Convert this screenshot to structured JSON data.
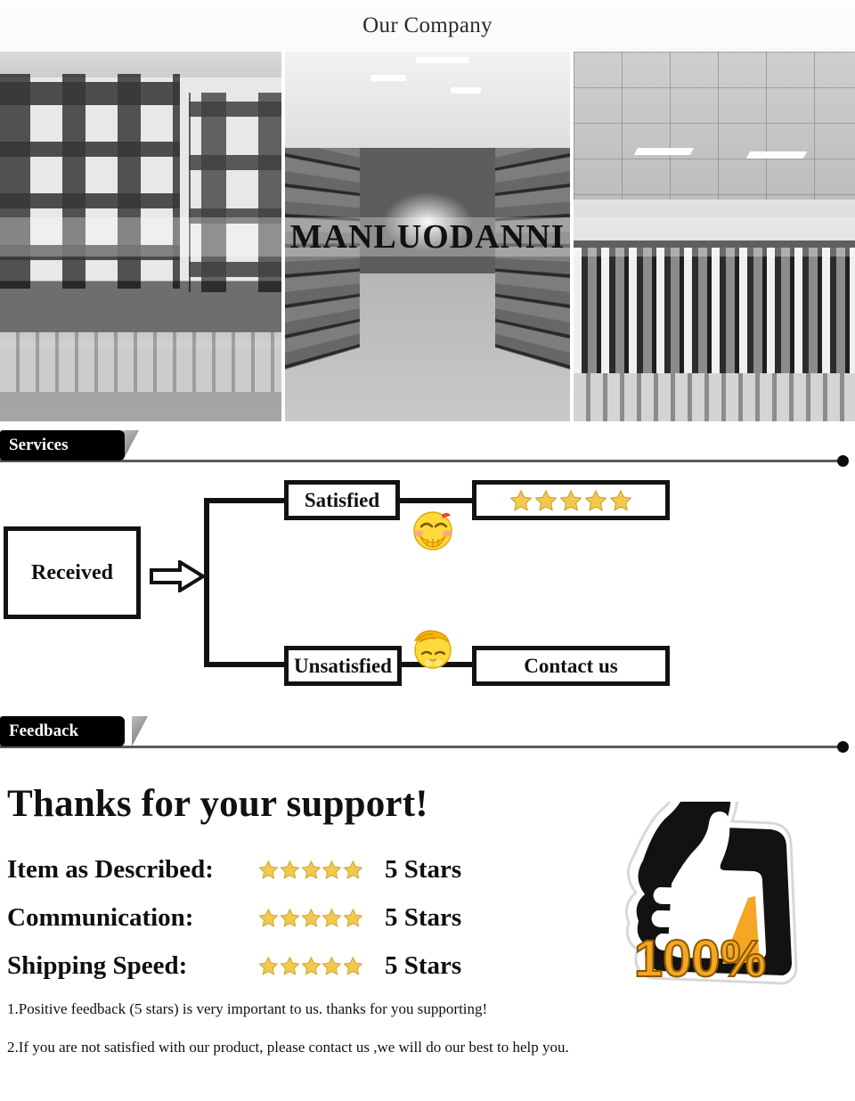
{
  "header": {
    "title": "Our Company"
  },
  "collage": {
    "watermark": "MANLUODANNI",
    "photos": [
      {
        "name": "factory-building-exterior",
        "alt": "Factory building exterior with stacked goods"
      },
      {
        "name": "warehouse-aisle",
        "alt": "Warehouse storage aisle with racks"
      },
      {
        "name": "showroom-clothing-racks",
        "alt": "Showroom with clothing racks and ceiling lights"
      }
    ]
  },
  "services": {
    "badge_label": "Services",
    "flow": {
      "start": "Received",
      "branch_top": "Satisfied",
      "branch_bottom": "Unsatisfied",
      "result_top_stars": 5,
      "result_bottom": "Contact us",
      "emoji_top": "happy-covering-mouth-emoji",
      "emoji_bottom": "facepalm-sad-emoji"
    }
  },
  "feedback": {
    "badge_label": "Feedback",
    "heading": "Thanks for your support!",
    "ratings": [
      {
        "label": "Item as Described:",
        "stars": 5,
        "value": "5 Stars"
      },
      {
        "label": "Communication:",
        "stars": 5,
        "value": "5 Stars"
      },
      {
        "label": "Shipping Speed:",
        "stars": 5,
        "value": "5 Stars"
      }
    ],
    "thumb_badge": {
      "percent": "100%",
      "icon": "thumbs-up-icon"
    },
    "notes": [
      "1.Positive feedback (5 stars) is very important to us. thanks for you supporting!",
      "2.If you are not satisfied with our product, please contact us ,we will do our best to help you."
    ]
  },
  "colors": {
    "badge_bg": "#000000",
    "rule": "#5a5a5a",
    "star": "#f2c94c",
    "thumb_yellow": "#f5a623",
    "text": "#111111"
  }
}
